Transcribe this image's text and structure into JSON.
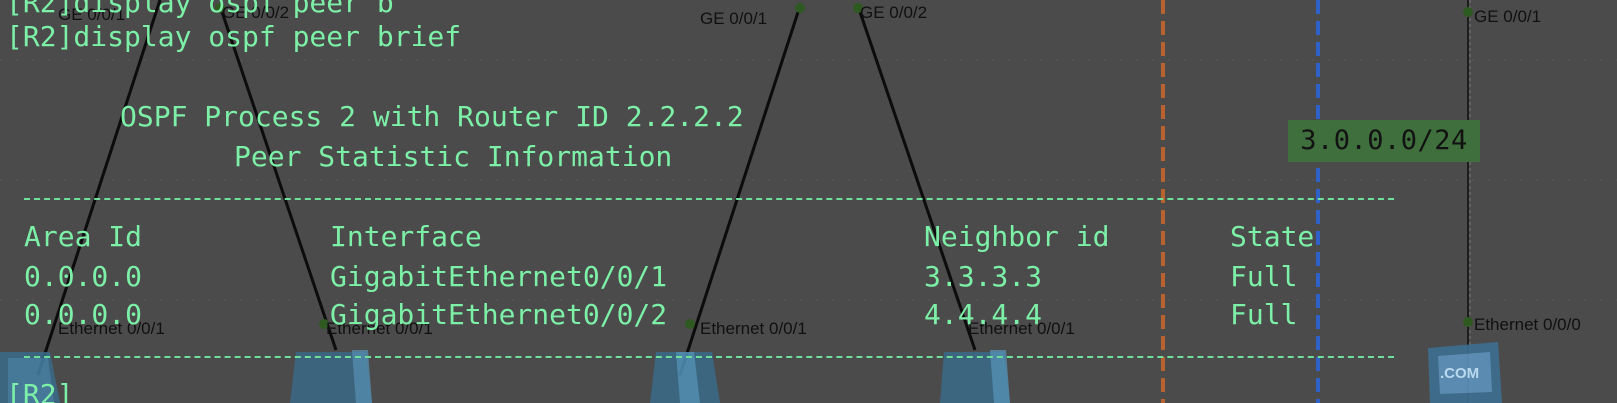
{
  "terminal": {
    "line_top": "[R2]display ospf peer b",
    "command": "[R2]display ospf peer brief",
    "process_line": "OSPF Process 2 with Router ID 2.2.2.2",
    "stats_line": "Peer Statistic Information",
    "headers": {
      "area": "Area Id",
      "interface": "Interface",
      "neighbor": "Neighbor id",
      "state": "State"
    },
    "rows": [
      {
        "area": "0.0.0.0",
        "interface": "GigabitEthernet0/0/1",
        "neighbor": "3.3.3.3",
        "state": "Full"
      },
      {
        "area": "0.0.0.0",
        "interface": "GigabitEthernet0/0/2",
        "neighbor": "4.4.4.4",
        "state": "Full"
      }
    ],
    "prompt": "[R2]"
  },
  "topology": {
    "ports": {
      "p1": "GE 0/0/1",
      "p2": "GE 0/0/2",
      "p3": "GE 0/0/1",
      "p4": "GE 0/0/2",
      "p5": "GE 0/0/1",
      "e1": "Ethernet 0/0/1",
      "e2": "Ethernet 0/0/1",
      "e3": "Ethernet 0/0/1",
      "e4": "Ethernet 0/0/1",
      "e5": "Ethernet 0/0/0"
    },
    "network_label": "3.0.0.0/24",
    "device_badge": ".COM",
    "colors": {
      "background": "#4b4b4b",
      "terminal_text": "#7df0a8",
      "link": "#0c0c0c",
      "orange_boundary": "#b8622f",
      "blue_boundary": "#2f62c9",
      "label_box": "#3f6f3c"
    }
  }
}
